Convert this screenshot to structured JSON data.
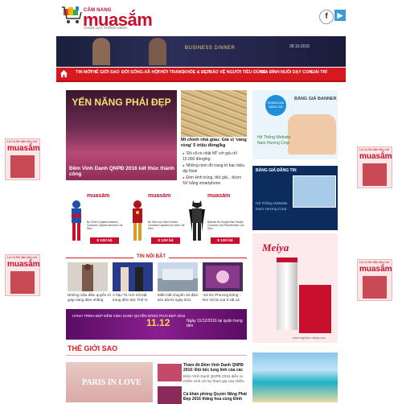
{
  "header": {
    "logo_small": "CẨM NANG",
    "logo_big": "muasắm",
    "logo_sub": "CHỌN LỰA THÔNG MINH",
    "social": [
      "f",
      "▶"
    ]
  },
  "top_banner": {
    "headline": "BUSINESS DINNER",
    "date_text": "28.10.2016"
  },
  "nav": {
    "items": [
      "TIN MỚI",
      "THẾ GIỚI SAO",
      "ĐỜI SỐNG-XÃ HỘI",
      "THỜI TRANG",
      "KHỎE & ĐẸP",
      "BẢO VỆ NGƯỜI TIÊU DÙNG",
      "GIA ĐÌNH",
      "NUÔI DẠY CON",
      "GIẢI TRÍ"
    ]
  },
  "side_ads": {
    "top_text": "Là Cô Bé dẫn đầu với",
    "brand": "muasắm"
  },
  "featured": {
    "image_title": "YẾN NĂNG PHÁI ĐẸP",
    "caption": "Đêm Vinh Danh QNPĐ 2016 kết thúc thành công"
  },
  "news": {
    "title": "Mì chính nhà giàu: Giá vị 'vàng ròng' 5 triệu đồng/kg",
    "bullets": [
      "'Đồ cổ-rà nhặt Mĩ' với giá chỉ 15.000 đồng/kg",
      "Những món đồ trang trí bạc triệu dịp Noel",
      "Đơn kinh trúng, thử giả... được 'lòi' bằng smartphone"
    ]
  },
  "right_ads": {
    "ad1_badge": "DOWNLOAD BẢNG GIÁ",
    "ad1_title": "BẢNG GIÁ BANNER",
    "ad1_text": [
      "Hệ Thống Website",
      "Nam Hương Corp"
    ],
    "ad2_title": "BẢNG GIÁ ĐĂNG TIN",
    "ad2_text": [
      "Hệ Thống Website",
      "Nam Hương Corp"
    ],
    "meiya_brand": "Meiya",
    "meiya_web": "www.mypham-meiya.com"
  },
  "costumes": [
    {
      "logo": "muasắm",
      "desc": "Bộ Chiến Captain America Costume Captain America Cat Siêu",
      "price": "$ 120/ bộ"
    },
    {
      "logo": "muasắm",
      "desc": "Bộ Siêu Iron Man Hoodie Costume Captain Iron Man Cát Siêu",
      "price": "$ 120/ bộ"
    },
    {
      "logo": "muasắm",
      "desc": "Batman Bộ Knight Bảo Hoodie Costume cho PlanHeroism Cat Siêu",
      "price": "$ 120/ bộ"
    }
  ],
  "section_title": "TIN NỔI BẬT",
  "highlights": [
    "Những mẫu đầm quyến rũ giúp nàng đảm nhắng",
    "A hậu Tú Anh nổi bật trong đêm tiệc Thế Vi",
    "Miền bất chuyển rét đậm kéo dài từ ngày 8/11",
    "'Sả tóc Phương Đông' - Nơi nối là của ít vất vả"
  ],
  "mid_banner": {
    "left": "HÀNH TRÌNH ĐẸP ĐÊM VINH DANH QUYẾN NĂNG PHÁI ĐẸP 2016",
    "date": "11.12",
    "right": "Ngày 11/12/2016 tại quận trung tâm"
  },
  "section2_title": "THẾ GIỚI SAO",
  "bottom": {
    "image_text": "PARIS IN LOVE",
    "items": [
      {
        "title": "Thảm đỏ Đêm Vinh Danh QNPĐ 2016: Đội tiếc lung linh của các",
        "desc": "Đêm Vinh Danh QNPĐ 2016 diễn ra nhằm vinh với sự tham gia của nhiều"
      },
      {
        "title": "Cá khán phóng Quyền Năng Phái Đẹp 2016 thăng hoa cùng Đinh",
        "desc": ""
      }
    ]
  }
}
